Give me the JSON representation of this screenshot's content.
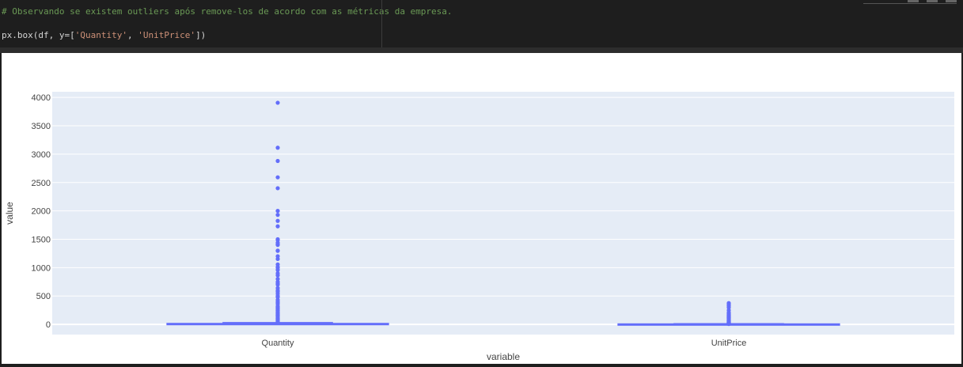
{
  "code": {
    "comment": "# Observando se existem outliers após remove-los de acordo com as métricas da empresa.",
    "line_prefix": "px.box(df, y=[",
    "arg1": "'Quantity'",
    "sep": ", ",
    "arg2": "'UnitPrice'",
    "line_suffix": "])"
  },
  "colors": {
    "plot_bg": "#e5ecf6",
    "grid": "#ffffff",
    "series": "#636efa"
  },
  "chart_data": {
    "type": "box",
    "xlabel": "variable",
    "ylabel": "value",
    "ylim": [
      -180,
      4100
    ],
    "yticks": [
      0,
      500,
      1000,
      1500,
      2000,
      2500,
      3000,
      3500,
      4000
    ],
    "ytick_labels": [
      "0",
      "500",
      "1000",
      "1500",
      "2000",
      "2500",
      "3000",
      "3500",
      "4000"
    ],
    "categories": [
      "Quantity",
      "UnitPrice"
    ],
    "grid": true,
    "boxes": [
      {
        "category": "Quantity",
        "min": 1,
        "q1": 2,
        "median": 6,
        "q3": 12,
        "max": 27,
        "outliers": [
          30,
          40,
          50,
          60,
          72,
          80,
          96,
          100,
          108,
          120,
          144,
          150,
          160,
          180,
          192,
          200,
          216,
          240,
          250,
          270,
          288,
          300,
          320,
          360,
          384,
          400,
          432,
          480,
          500,
          540,
          576,
          600,
          640,
          700,
          720,
          750,
          800,
          864,
          900,
          960,
          1000,
          1010,
          1056,
          1152,
          1200,
          1296,
          1300,
          1400,
          1412,
          1440,
          1488,
          1500,
          1728,
          1824,
          1930,
          2000,
          2400,
          2592,
          2880,
          3114,
          3906
        ]
      },
      {
        "category": "UnitPrice",
        "min": 0.001,
        "q1": 1.25,
        "median": 1.95,
        "q3": 3.75,
        "max": 7.5,
        "outliers": [
          8,
          8.5,
          9.95,
          10.95,
          12.5,
          14.95,
          16.95,
          18,
          19.95,
          22,
          24.95,
          29.95,
          35,
          39.95,
          45,
          50,
          59.95,
          65,
          75,
          85,
          99,
          110,
          120,
          125,
          135,
          145,
          150,
          165,
          175,
          195,
          210,
          250,
          295,
          325,
          350,
          375
        ]
      }
    ]
  }
}
